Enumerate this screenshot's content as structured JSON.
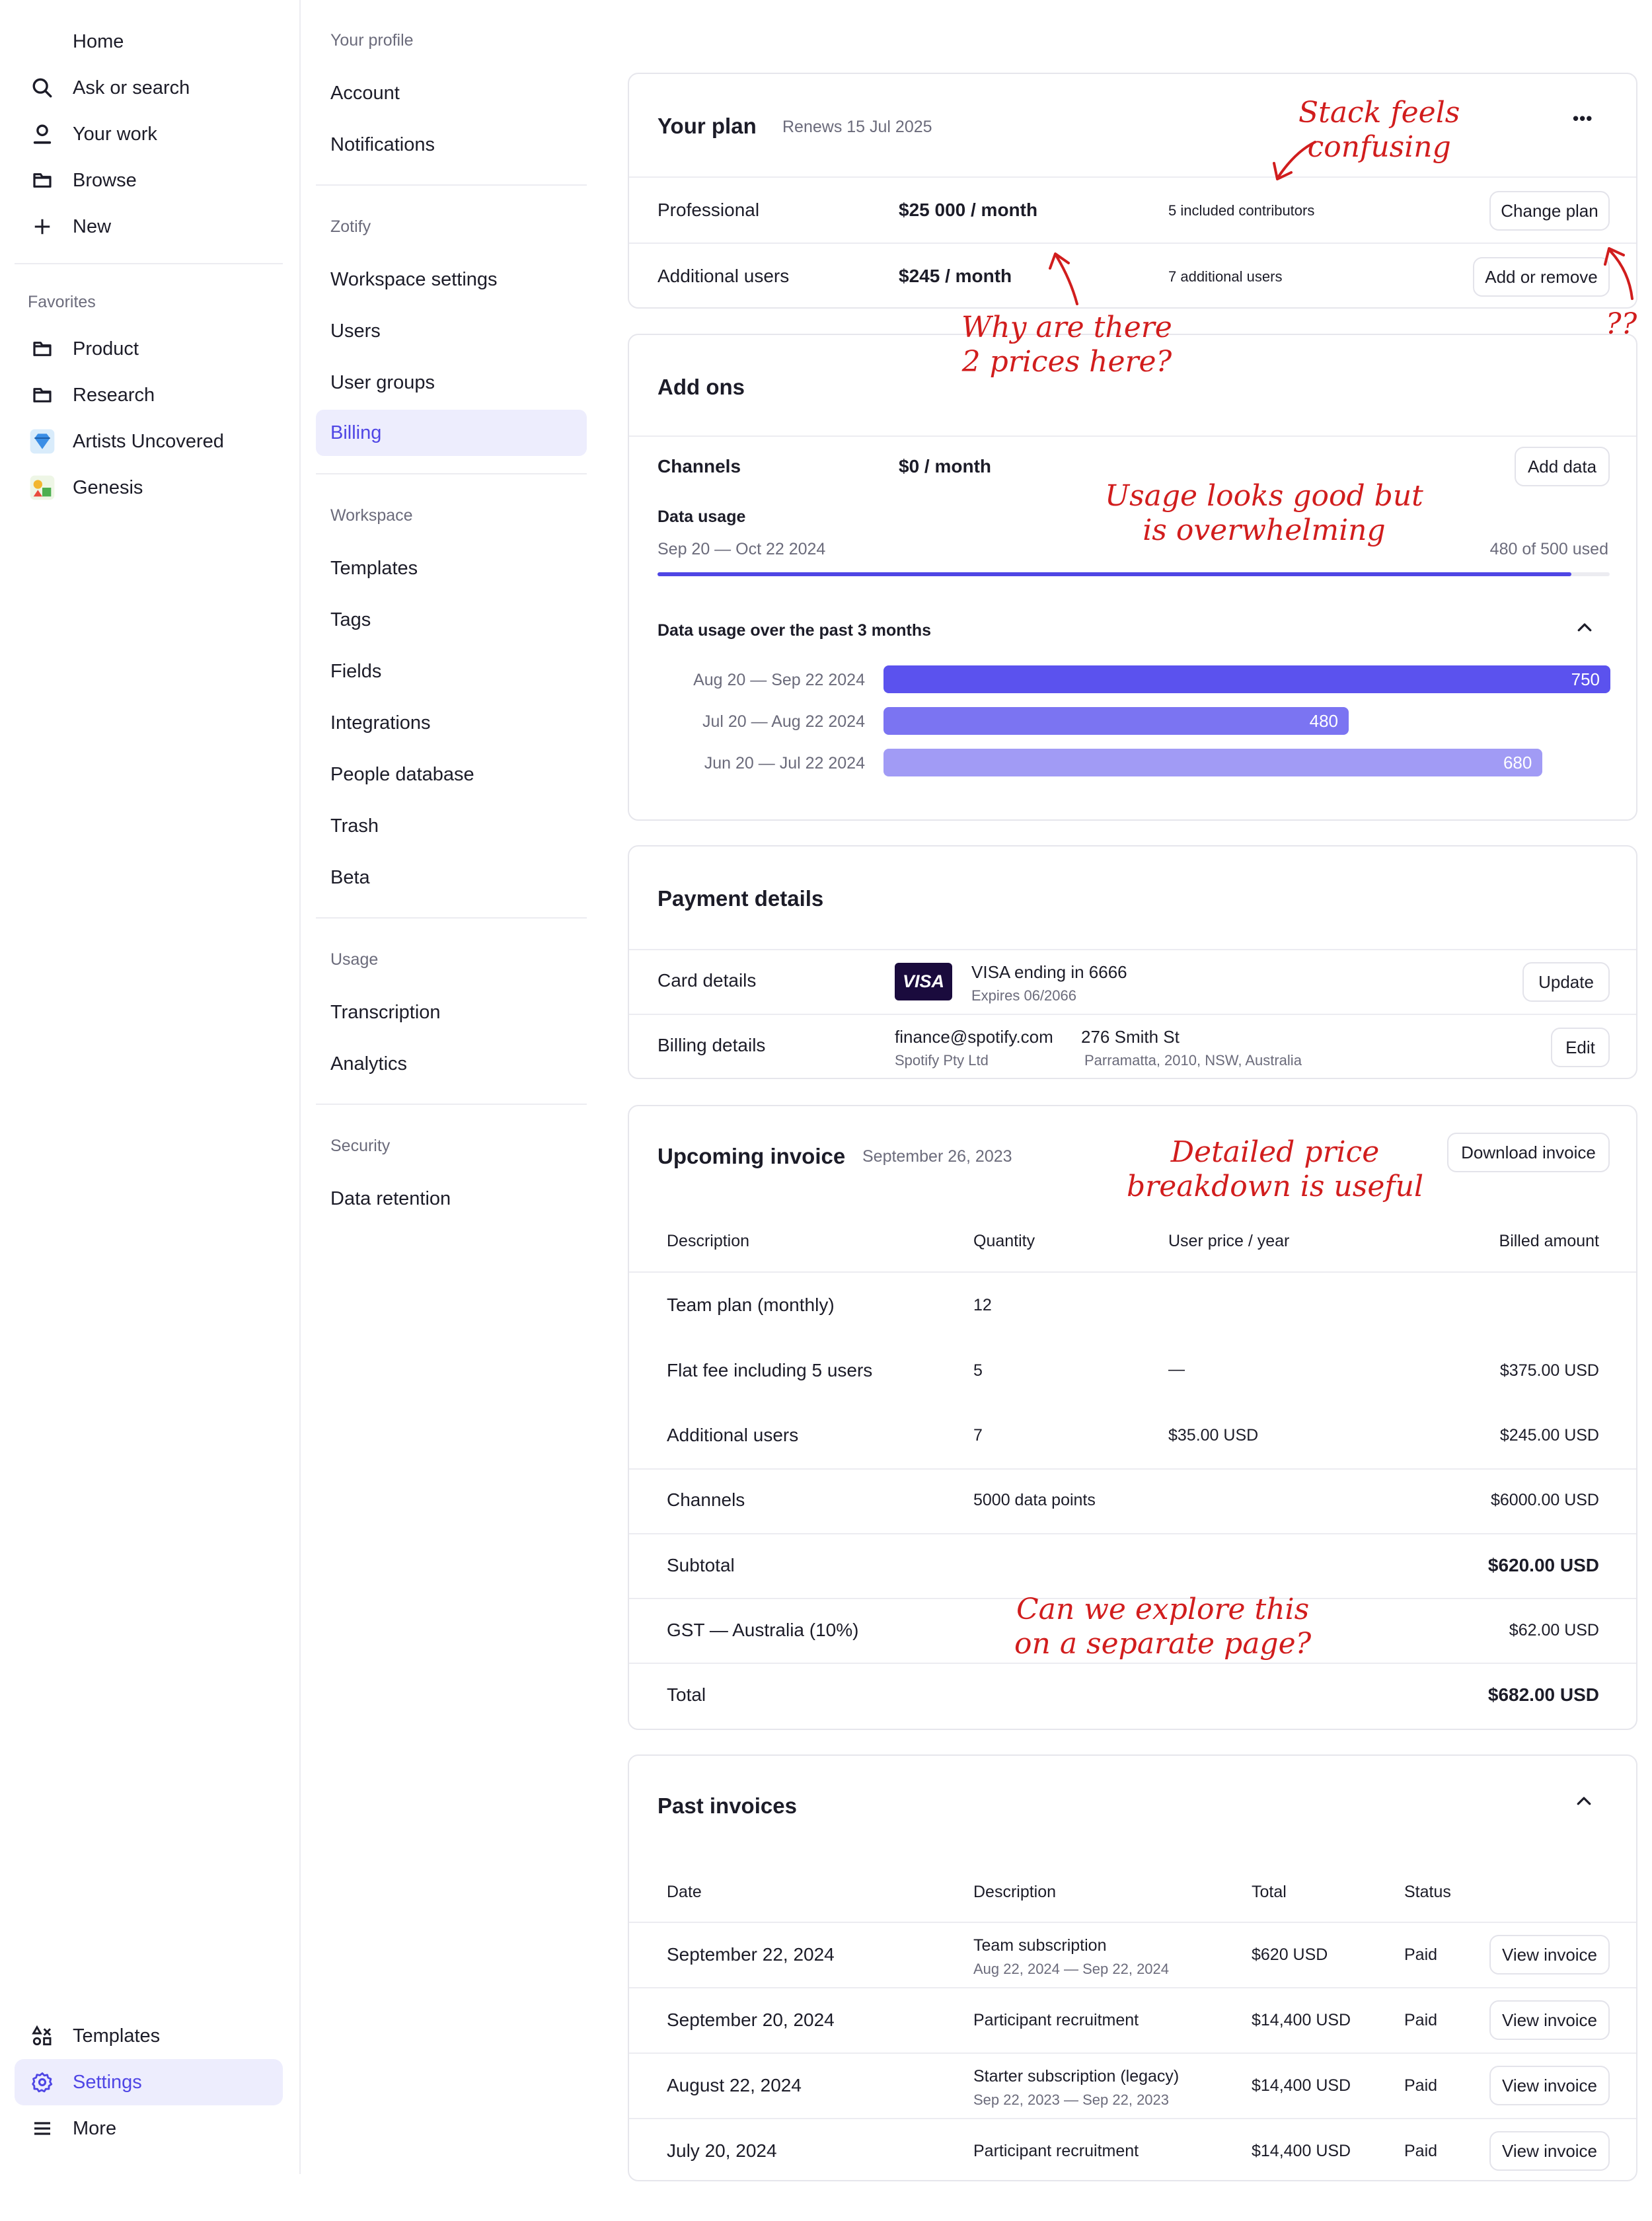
{
  "nav": {
    "items": [
      {
        "label": "Home"
      },
      {
        "label": "Ask or search"
      },
      {
        "label": "Your work"
      },
      {
        "label": "Browse"
      },
      {
        "label": "New"
      }
    ],
    "favorites_label": "Favorites",
    "favorites": [
      {
        "label": "Product"
      },
      {
        "label": "Research"
      },
      {
        "label": "Artists Uncovered"
      },
      {
        "label": "Genesis"
      }
    ],
    "bottom": [
      {
        "label": "Templates"
      },
      {
        "label": "Settings"
      },
      {
        "label": "More"
      }
    ]
  },
  "settings_menu": {
    "profile_label": "Your profile",
    "profile": [
      "Account",
      "Notifications"
    ],
    "org_label": "Zotify",
    "org": [
      "Workspace settings",
      "Users",
      "User groups",
      "Billing"
    ],
    "workspace_label": "Workspace",
    "workspace": [
      "Templates",
      "Tags",
      "Fields",
      "Integrations",
      "People database",
      "Trash",
      "Beta"
    ],
    "usage_label": "Usage",
    "usage": [
      "Transcription",
      "Analytics"
    ],
    "security_label": "Security",
    "security": [
      "Data retention"
    ]
  },
  "plan": {
    "title": "Your plan",
    "renews": "Renews 15 Jul 2025",
    "more": "•••",
    "rows": [
      {
        "name": "Professional",
        "price": "$25 000 / month",
        "info": "5 included contributors",
        "action": "Change plan"
      },
      {
        "name": "Additional users",
        "price": "$245 / month",
        "info": "7 additional users",
        "action": "Add or remove"
      }
    ]
  },
  "addons": {
    "title": "Add ons",
    "channels": "Channels",
    "channels_price": "$0 / month",
    "add_data": "Add data",
    "data_usage": "Data usage",
    "period": "Sep 20 — Oct 22 2024",
    "used": "480 of 500 used",
    "usage_fraction": 0.96,
    "history_title": "Data usage over the past 3 months"
  },
  "chart_data": {
    "type": "bar",
    "categories": [
      "Aug 20 — Sep 22 2024",
      "Jul 20 — Aug 22 2024",
      "Jun 20 — Jul 22 2024"
    ],
    "values": [
      750,
      480,
      680
    ],
    "colors": [
      "#5b52ee",
      "#7b74f2",
      "#a19bf5"
    ]
  },
  "payment": {
    "title": "Payment details",
    "card_label": "Card details",
    "card_brand": "VISA",
    "card_text": "VISA ending in 6666",
    "card_expiry": "Expires 06/2066",
    "update": "Update",
    "billing_label": "Billing details",
    "email": "finance@spotify.com",
    "company": "Spotify Pty Ltd",
    "street": "276 Smith St",
    "city": "Parramatta, 2010, NSW, Australia",
    "edit": "Edit"
  },
  "invoice": {
    "title": "Upcoming invoice",
    "date": "September 26, 2023",
    "download": "Download invoice",
    "headers": [
      "Description",
      "Quantity",
      "User price / year",
      "Billed amount"
    ],
    "rows": [
      [
        "Team plan (monthly)",
        "12",
        "",
        ""
      ],
      [
        "Flat fee including 5 users",
        "5",
        "—",
        "$375.00 USD"
      ],
      [
        "Additional users",
        "7",
        "$35.00 USD",
        "$245.00 USD"
      ],
      [
        "Channels",
        "5000 data points",
        "",
        "$6000.00 USD"
      ]
    ],
    "subtotal_label": "Subtotal",
    "subtotal": "$620.00 USD",
    "gst_label": "GST — Australia (10%)",
    "gst": "$62.00 USD",
    "total_label": "Total",
    "total": "$682.00 USD"
  },
  "past": {
    "title": "Past invoices",
    "headers": [
      "Date",
      "Description",
      "Total",
      "Status"
    ],
    "rows": [
      {
        "date": "September 22, 2024",
        "desc": "Team subscription",
        "period": "Aug 22, 2024 — Sep 22, 2024",
        "total": "$620 USD",
        "status": "Paid",
        "action": "View invoice"
      },
      {
        "date": "September 20, 2024",
        "desc": "Participant recruitment",
        "period": "",
        "total": "$14,400 USD",
        "status": "Paid",
        "action": "View invoice"
      },
      {
        "date": "August 22, 2024",
        "desc": "Starter subscription (legacy)",
        "period": "Sep 22, 2023 — Sep 22, 2023",
        "total": "$14,400 USD",
        "status": "Paid",
        "action": "View invoice"
      },
      {
        "date": "July 20, 2024",
        "desc": "Participant recruitment",
        "period": "",
        "total": "$14,400 USD",
        "status": "Paid",
        "action": "View invoice"
      }
    ]
  },
  "notes": {
    "n1a": "Stack feels",
    "n1b": "confusing",
    "n2a": "Why are there",
    "n2b": "2 prices here?",
    "n3": "??",
    "n4a": "Usage looks good but",
    "n4b": "is overwhelming",
    "n5a": "Detailed price",
    "n5b": "breakdown is useful",
    "n6a": "Can we explore this",
    "n6b": "on a separate page?"
  },
  "colors": {
    "accent": "#4f46e5",
    "note": "#d11d1d",
    "visa_bg": "#1a0b3d"
  }
}
